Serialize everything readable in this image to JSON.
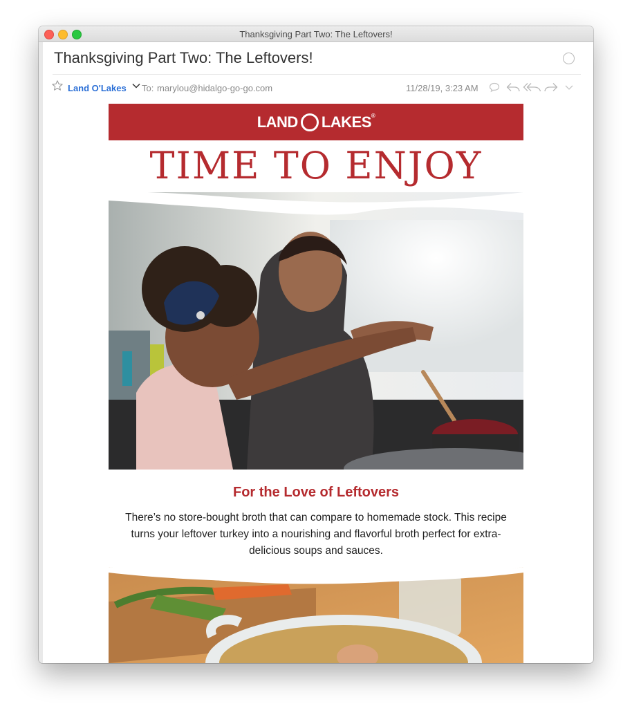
{
  "window": {
    "title": "Thanksgiving Part Two: The Leftovers!"
  },
  "message": {
    "subject": "Thanksgiving Part Two: The Leftovers!",
    "sender": "Land O'Lakes",
    "to_label": "To:",
    "to_address": "marylou@hidalgo-go-go.com",
    "date": "11/28/19, 3:23 AM"
  },
  "email": {
    "logo": {
      "left": "LAND",
      "right": "LAKES",
      "mark": "®"
    },
    "headline": "TIME TO ENJOY",
    "section": {
      "title": "For the Love of Leftovers",
      "body": "There’s no store-bought broth that can compare to homemade stock. This recipe turns your leftover turkey into a nourishing and flavorful broth perfect for extra-delicious soups and sauces."
    }
  },
  "colors": {
    "brand_red": "#b52b2f",
    "sender_blue": "#2b6fd6",
    "meta_gray": "#8a8a8a"
  },
  "icons": [
    "star-icon",
    "chevron-down-icon",
    "speech-bubble-icon",
    "reply-icon",
    "reply-all-icon",
    "forward-icon",
    "more-chevron-icon"
  ]
}
